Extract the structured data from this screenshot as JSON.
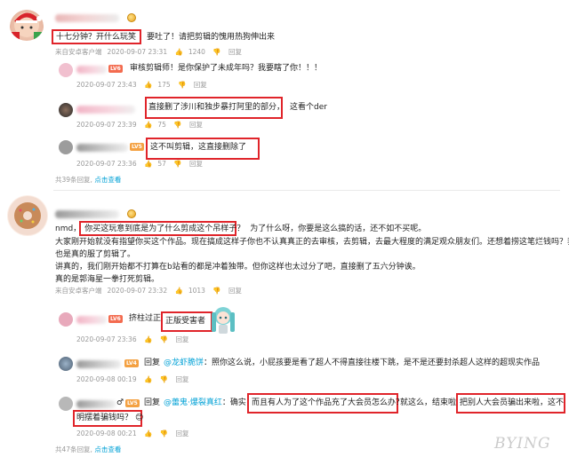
{
  "thread1": {
    "comment": {
      "highlight": "十七分钟？开什么玩笑",
      "rest": "要吐了！请把剪辑的愧用热狗伸出来"
    },
    "meta": {
      "source": "来自安卓客户端",
      "time": "2020-09-07 23:31",
      "likes": "1240",
      "reply": "回复"
    },
    "replies": [
      {
        "text": "审核剪辑师！是你保护了未成年吗？我要瞎了你！！！",
        "time": "2020-09-07 23:43",
        "likes": "175",
        "reply": "回复"
      },
      {
        "highlight": "直接删了涉川和独步暴打阿里的部分，",
        "rest": "这看个der",
        "time": "2020-09-07 23:39",
        "likes": "75",
        "reply": "回复"
      },
      {
        "highlight": "这不叫剪辑，这直接删除了",
        "time": "2020-09-07 23:36",
        "likes": "57",
        "reply": "回复"
      }
    ],
    "footer": {
      "count": "共39条回复,",
      "action": "点击查看"
    }
  },
  "thread2": {
    "comment": {
      "prefix": "nmd，",
      "highlight": "你买这玩意到底是为了什么剪成这个吊样子？",
      "rest": "为了什么呀，你要是这么搞的话，还不如不买呢。",
      "line2": "大家刚开始就没有指望你买这个作品。现在搞成这样子你也不认真真正的去审核，去剪辑，去最大程度的满足观众朋友们。还想着捞这笔烂钱吗？我",
      "line3": "也是真的服了剪辑了。",
      "line4": "讲真的，我们刚开始都不打算在b站看的都是冲着独带。但你这样也太过分了吧，直接删了五六分钟诶。",
      "line5": "真的是郭海星一拳打死剪辑。"
    },
    "meta": {
      "source": "来自安卓客户端",
      "time": "2020-09-07 23:32",
      "likes": "1013",
      "reply": "回复"
    },
    "replies": [
      {
        "prefix": "挤柱过正",
        "highlight": "正版受害者",
        "time": "2020-09-07 23:36",
        "likes": "",
        "reply": "回复"
      },
      {
        "reply_label": "回复",
        "mention": "@龙虾脆饼",
        "rest": "：照你这么说，小屁孩要是看了超人不得直接往楼下跳，是不是还要封杀超人这样的超现实作品",
        "time": "2020-09-08 00:19",
        "likes": "",
        "reply": "回复"
      },
      {
        "reply_label": "回复",
        "mention": "@蕾鬼·爆裂真红",
        "prefix": "：确实，",
        "highlight": "而且有人为了这个作品充了大会员怎么办？",
        "mid": "就这么，结束啦",
        "highlight2": "把别人大会员骗出来啦，这不",
        "highlight3": "明摆着骗钱吗？",
        "emoji": "😊",
        "time": "2020-09-08 00:21",
        "likes": "",
        "reply": "回复"
      }
    ],
    "footer": {
      "count": "共47条回复,",
      "action": "点击查看"
    }
  },
  "watermark": "BYING",
  "colors": {
    "highlight_border": "#e0242a",
    "link": "#00a1d6",
    "meta": "#999999"
  },
  "icons": [
    "santa-avatar-icon",
    "donut-avatar-icon",
    "thumb-up-icon",
    "thumb-down-icon",
    "medal-icon",
    "level-badge-icon",
    "hatsune-miku-sticker"
  ]
}
